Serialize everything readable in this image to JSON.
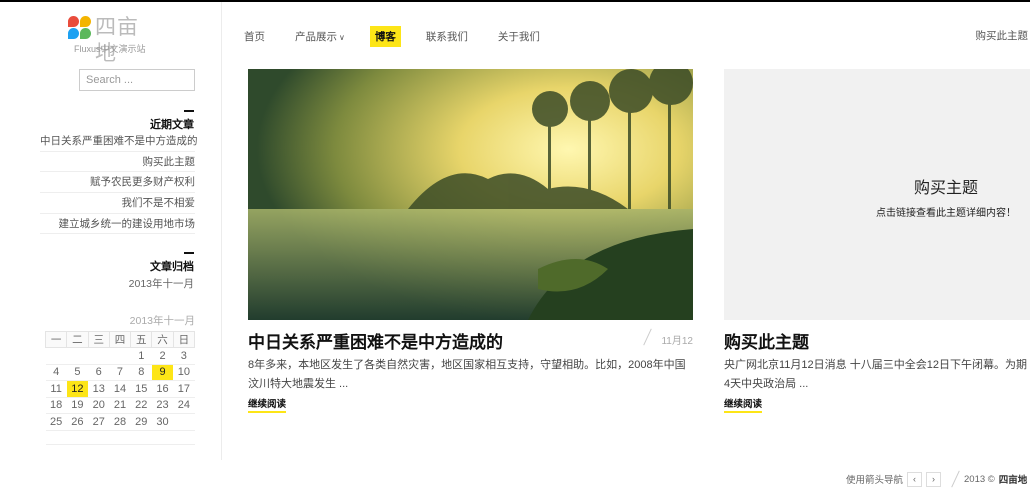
{
  "logo": {
    "name": "四亩地",
    "tagline": "Fluxus中文演示站"
  },
  "search": {
    "placeholder": "Search ..."
  },
  "recent": {
    "title": "近期文章",
    "items": [
      "中日关系严重困难不是中方造成的",
      "购买此主题",
      "赋予农民更多财产权利",
      "我们不是不相爱",
      "建立城乡统一的建设用地市场"
    ]
  },
  "archive": {
    "title": "文章归档",
    "item": "2013年十一月"
  },
  "calendar": {
    "caption": "2013年十一月",
    "weekdays": [
      "一",
      "二",
      "三",
      "四",
      "五",
      "六",
      "日"
    ],
    "weeks": [
      [
        "",
        "",
        "",
        "",
        "1",
        "2",
        "3"
      ],
      [
        "4",
        "5",
        "6",
        "7",
        "8",
        "9",
        "10"
      ],
      [
        "11",
        "12",
        "13",
        "14",
        "15",
        "16",
        "17"
      ],
      [
        "18",
        "19",
        "20",
        "21",
        "22",
        "23",
        "24"
      ],
      [
        "25",
        "26",
        "27",
        "28",
        "29",
        "30",
        ""
      ]
    ],
    "highlighted": [
      "9",
      "12"
    ]
  },
  "nav": {
    "items": [
      {
        "label": "首页",
        "active": false
      },
      {
        "label": "产品展示",
        "active": false,
        "dropdown": true
      },
      {
        "label": "博客",
        "active": true
      },
      {
        "label": "联系我们",
        "active": false
      },
      {
        "label": "关于我们",
        "active": false
      }
    ],
    "buy": "购买此主题"
  },
  "posts": [
    {
      "title": "中日关系严重困难不是中方造成的",
      "date": "11月12",
      "excerpt": "8年多来，本地区发生了各类自然灾害，地区国家相互支持，守望相助。比如，2008年中国汶川特大地震发生 ...",
      "more": "继续阅读"
    },
    {
      "promo_title": "购买主题",
      "promo_sub": "点击链接查看此主题详细内容！",
      "title": "购买此主题",
      "excerpt": "央广网北京11月12日消息 十八届三中全会12日下午闭幕。为期4天中央政治局 ...",
      "more": "继续阅读"
    }
  ],
  "footer": {
    "nav_hint": "使用箭头导航",
    "prev": "‹",
    "next": "›",
    "copyright": "2013 ©",
    "brand": "四亩地"
  },
  "colors": {
    "accent": "#fde517"
  }
}
